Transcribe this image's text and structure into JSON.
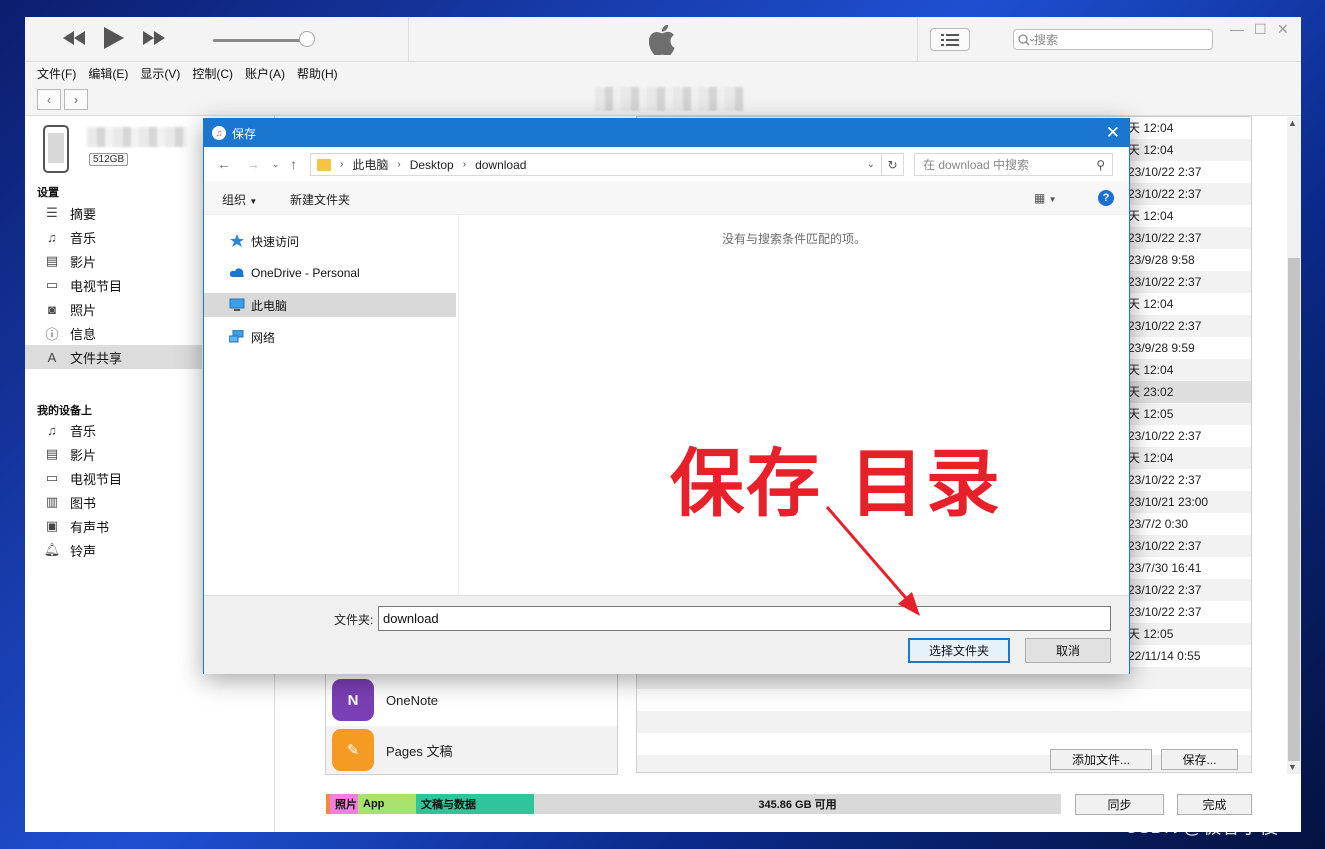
{
  "menu": [
    "文件(F)",
    "编辑(E)",
    "显示(V)",
    "控制(C)",
    "账户(A)",
    "帮助(H)"
  ],
  "search_placeholder": "搜索",
  "device": {
    "capacity": "512GB"
  },
  "sidebar": {
    "settings_title": "设置",
    "settings_items": [
      "摘要",
      "音乐",
      "影片",
      "电视节目",
      "照片",
      "信息",
      "文件共享"
    ],
    "ondevice_title": "我的设备上",
    "ondevice_items": [
      "音乐",
      "影片",
      "电视节目",
      "图书",
      "有声书",
      "铃声"
    ]
  },
  "file_rows": [
    "天 12:04",
    "天 12:04",
    "23/10/22 2:37",
    "23/10/22 2:37",
    "天 12:04",
    "23/10/22 2:37",
    "23/9/28 9:58",
    "23/10/22 2:37",
    "天 12:04",
    "23/10/22 2:37",
    "23/9/28 9:59",
    "天 12:04",
    "天 23:02",
    "天 12:05",
    "23/10/22 2:37",
    "天 12:04",
    "23/10/22 2:37",
    "23/10/21 23:00",
    "23/7/2 0:30",
    "23/10/22 2:37",
    "23/7/30 16:41",
    "23/10/22 2:37",
    "23/10/22 2:37",
    "天 12:05",
    "22/11/14 0:55"
  ],
  "apps": [
    {
      "name": "OneNote",
      "icon": "onenote-icon",
      "color": "#7b3fb5"
    },
    {
      "name": "Pages 文稿",
      "icon": "pages-icon",
      "color": "#f59a23"
    }
  ],
  "buttons": {
    "add_file": "添加文件...",
    "save": "保存...",
    "sync": "同步",
    "done": "完成"
  },
  "storage": {
    "photos": "照片",
    "app": "App",
    "docs": "文稿与数据",
    "free": "345.86 GB 可用",
    "colors": {
      "photos": "#f27fd8",
      "app": "#a7e26a",
      "docs": "#2fc59a",
      "free": "#d9d9d9"
    }
  },
  "dialog": {
    "title": "保存",
    "breadcrumb": [
      "此电脑",
      "Desktop",
      "download"
    ],
    "search_placeholder": "在 download 中搜索",
    "organize": "组织",
    "new_folder": "新建文件夹",
    "nav": [
      "快速访问",
      "OneDrive - Personal",
      "此电脑",
      "网络"
    ],
    "empty_message": "没有与搜索条件匹配的项。",
    "folder_label": "文件夹:",
    "folder_value": "download",
    "select_button": "选择文件夹",
    "cancel_button": "取消"
  },
  "annotation": "保存 目录",
  "watermark": "CSDN @极客小俊"
}
